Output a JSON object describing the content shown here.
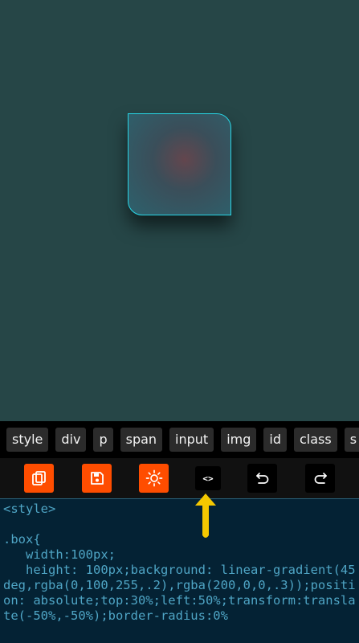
{
  "tags": [
    "style",
    "div",
    "p",
    "span",
    "input",
    "img",
    "id",
    "class",
    "s"
  ],
  "toolbar": {
    "copy_icon": "copy-icon",
    "save_icon": "save-icon",
    "theme_icon": "sun-icon",
    "code_label": "<>",
    "undo_icon": "undo-icon",
    "redo_icon": "redo-icon"
  },
  "editor": {
    "code": "<style>\n\n.box{\n   width:100px;\n   height: 100px;background: linear-gradient(45deg,rgba(0,100,255,.2),rgba(200,0,0,.3));position: absolute;top:30%;left:50%;transform:translate(-50%,-50%);border-radius:0%"
  },
  "colors": {
    "accent_orange": "#ff4d00",
    "box_border": "#28d6e6",
    "arrow_yellow": "#f5c800",
    "editor_text": "#4fa5c5"
  }
}
